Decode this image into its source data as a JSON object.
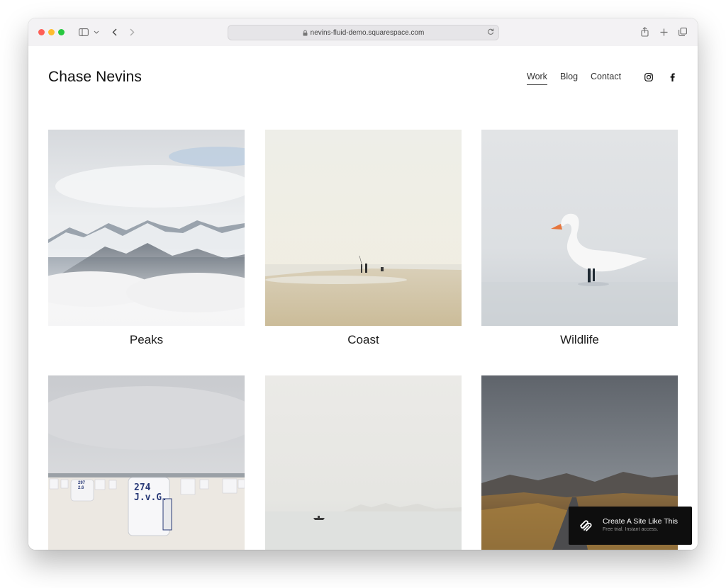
{
  "browser": {
    "url": "nevins-fluid-demo.squarespace.com",
    "icons": [
      "sidebar-icon",
      "chevron-down-icon",
      "back-icon",
      "forward-icon",
      "lock-icon",
      "reload-icon",
      "share-icon",
      "new-tab-icon",
      "tabs-overview-icon"
    ]
  },
  "site": {
    "title": "Chase Nevins",
    "nav": [
      {
        "label": "Work",
        "active": true
      },
      {
        "label": "Blog",
        "active": false
      },
      {
        "label": "Contact",
        "active": false
      }
    ],
    "social": [
      "instagram-icon",
      "facebook-icon"
    ]
  },
  "gallery": [
    {
      "caption": "Peaks",
      "scene": "snowy mountain peaks above clouds"
    },
    {
      "caption": "Coast",
      "scene": "figures on a misty beach"
    },
    {
      "caption": "Wildlife",
      "scene": "white swan standing in shallow water"
    },
    {
      "caption": "",
      "scene": "beach chairs on white sand"
    },
    {
      "caption": "",
      "scene": "small boat on foggy sea"
    },
    {
      "caption": "",
      "scene": "road through autumn highlands"
    }
  ],
  "beach_chair_labels": {
    "chair_small": "297\n2.6",
    "chair_large": "274\nJ.v.G."
  },
  "cta": {
    "title": "Create A Site Like This",
    "subtitle": "Free trial. Instant access."
  },
  "colors": {
    "toolbar": "#f3f2f4",
    "cta_bg": "#0e0e0e",
    "text": "#111111"
  }
}
